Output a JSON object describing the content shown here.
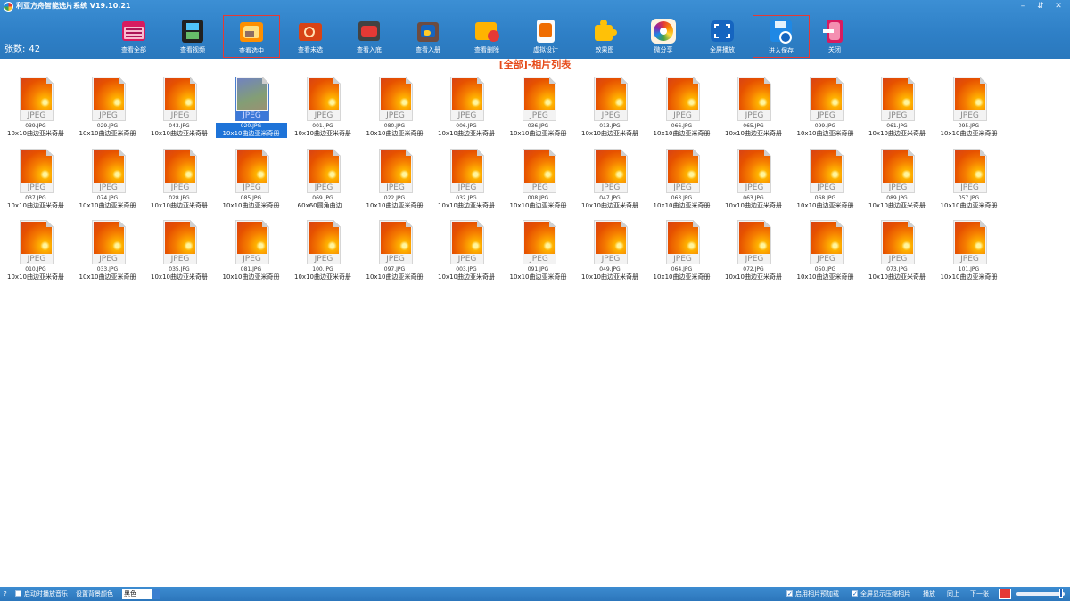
{
  "app": {
    "title": "利亚方舟智能选片系统 V19.10.21",
    "window_buttons": [
      "–",
      "⇵",
      "✕"
    ]
  },
  "count": {
    "label": "张数:",
    "value": "42"
  },
  "toolbar": [
    {
      "label": "查看全部",
      "icon": "calendar-grid-icon",
      "boxed": false
    },
    {
      "label": "查看视频",
      "icon": "film-icon",
      "boxed": false
    },
    {
      "label": "查看选中",
      "icon": "picture-folder-icon",
      "boxed": true
    },
    {
      "label": "查看未选",
      "icon": "folder-search-icon",
      "boxed": false
    },
    {
      "label": "查看入底",
      "icon": "film-clapper-icon",
      "boxed": false
    },
    {
      "label": "查看入册",
      "icon": "photo-album-icon",
      "boxed": false
    },
    {
      "label": "查看删除",
      "icon": "folder-delete-icon",
      "boxed": false
    },
    {
      "label": "虚拟设计",
      "icon": "design-sheet-icon",
      "boxed": false
    },
    {
      "label": "效果图",
      "icon": "puzzle-icon",
      "boxed": false
    },
    {
      "label": "微分享",
      "icon": "aperture-icon",
      "boxed": false
    },
    {
      "label": "全屏播放",
      "icon": "fullscreen-icon",
      "boxed": false
    },
    {
      "label": "进入保存",
      "icon": "save-disk-icon",
      "boxed": true
    },
    {
      "label": "关闭",
      "icon": "exit-door-icon",
      "boxed": false
    }
  ],
  "section_title": "[全部]-相片列表",
  "thumb_ext": "JPEG",
  "photos": [
    {
      "name": "039.JPG",
      "desc": "10x10曲边亚米奇册"
    },
    {
      "name": "029.JPG",
      "desc": "10x10曲边亚米奇册"
    },
    {
      "name": "043.JPG",
      "desc": "10x10曲边亚米奇册"
    },
    {
      "name": "020.JPG",
      "desc": "10x10曲边亚米奇册",
      "selected": true
    },
    {
      "name": "001.JPG",
      "desc": "10x10曲边亚米奇册"
    },
    {
      "name": "080.JPG",
      "desc": "10x10曲边亚米奇册"
    },
    {
      "name": "006.JPG",
      "desc": "10x10曲边亚米奇册"
    },
    {
      "name": "036.JPG",
      "desc": "10x10曲边亚米奇册"
    },
    {
      "name": "013.JPG",
      "desc": "10x10曲边亚米奇册"
    },
    {
      "name": "066.JPG",
      "desc": "10x10曲边亚米奇册"
    },
    {
      "name": "065.JPG",
      "desc": "10x10曲边亚米奇册"
    },
    {
      "name": "099.JPG",
      "desc": "10x10曲边亚米奇册"
    },
    {
      "name": "061.JPG",
      "desc": "10x10曲边亚米奇册"
    },
    {
      "name": "095.JPG",
      "desc": "10x10曲边亚米奇册"
    },
    {
      "name": "037.JPG",
      "desc": "10x10曲边亚米奇册"
    },
    {
      "name": "074.JPG",
      "desc": "10x10曲边亚米奇册"
    },
    {
      "name": "028.JPG",
      "desc": "10x10曲边亚米奇册"
    },
    {
      "name": "085.JPG",
      "desc": "10x10曲边亚米奇册"
    },
    {
      "name": "069.JPG",
      "desc": "60x60圆角曲边..."
    },
    {
      "name": "022.JPG",
      "desc": "10x10曲边亚米奇册"
    },
    {
      "name": "032.JPG",
      "desc": "10x10曲边亚米奇册"
    },
    {
      "name": "008.JPG",
      "desc": "10x10曲边亚米奇册"
    },
    {
      "name": "047.JPG",
      "desc": "10x10曲边亚米奇册"
    },
    {
      "name": "063.JPG",
      "desc": "10x10曲边亚米奇册"
    },
    {
      "name": "063.JPG",
      "desc": "10x10曲边亚米奇册"
    },
    {
      "name": "068.JPG",
      "desc": "10x10曲边亚米奇册"
    },
    {
      "name": "089.JPG",
      "desc": "10x10曲边亚米奇册"
    },
    {
      "name": "057.JPG",
      "desc": "10x10曲边亚米奇册"
    },
    {
      "name": "010.JPG",
      "desc": "10x10曲边亚米奇册"
    },
    {
      "name": "033.JPG",
      "desc": "10x10曲边亚米奇册"
    },
    {
      "name": "035.JPG",
      "desc": "10x10曲边亚米奇册"
    },
    {
      "name": "081.JPG",
      "desc": "10x10曲边亚米奇册"
    },
    {
      "name": "100.JPG",
      "desc": "10x10曲边亚米奇册"
    },
    {
      "name": "097.JPG",
      "desc": "10x10曲边亚米奇册"
    },
    {
      "name": "003.JPG",
      "desc": "10x10曲边亚米奇册"
    },
    {
      "name": "091.JPG",
      "desc": "10x10曲边亚米奇册"
    },
    {
      "name": "049.JPG",
      "desc": "10x10曲边亚米奇册"
    },
    {
      "name": "064.JPG",
      "desc": "10x10曲边亚米奇册"
    },
    {
      "name": "072.JPG",
      "desc": "10x10曲边亚米奇册"
    },
    {
      "name": "050.JPG",
      "desc": "10x10曲边亚米奇册"
    },
    {
      "name": "073.JPG",
      "desc": "10x10曲边亚米奇册"
    },
    {
      "name": "101.JPG",
      "desc": "10x10曲边亚米奇册"
    }
  ],
  "statusbar": {
    "help": "?",
    "music_checkbox": "启动时播放音乐",
    "bg_color_label": "设置背景颜色",
    "bg_color_value": "黑色",
    "preload_checkbox": "启用相片预加载",
    "fullscreen_checkbox": "全屏显示压缩相片",
    "play": "播放",
    "prev": "同上",
    "next": "下一张"
  },
  "colors": {
    "header": "#2e7fc6",
    "section_title": "#e64a19",
    "highlight_box": "#e53935",
    "selection": "#1e73d8"
  }
}
